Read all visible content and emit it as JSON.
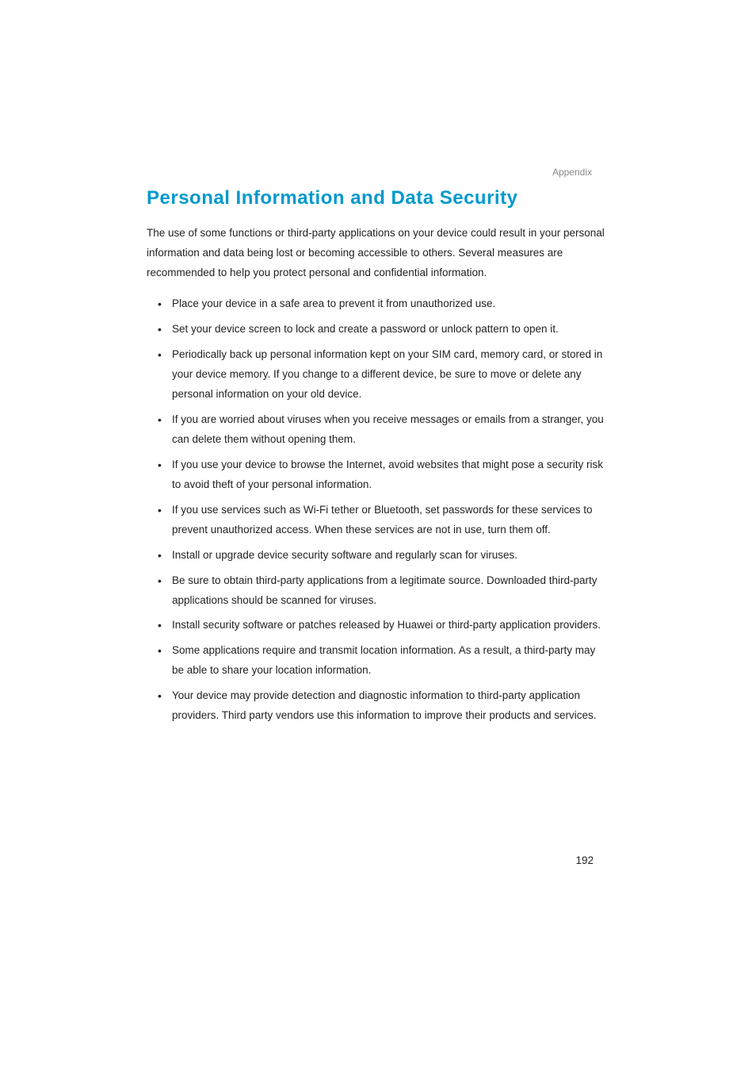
{
  "header": {
    "section_label": "Appendix"
  },
  "title": "Personal Information and Data Security",
  "intro": "The use of some functions or third-party applications on your device could result in your personal information and data being lost or becoming accessible to others. Several measures are recommended to help you protect personal and confidential information.",
  "bullets": [
    "Place your device in a safe area to prevent it from unauthorized use.",
    "Set your device screen to lock and create a password or unlock pattern to open it.",
    "Periodically back up personal information kept on your SIM card, memory card, or stored in your device memory. If you change to a different device, be sure to move or delete any personal information on your old device.",
    "If you are worried about viruses when you receive messages or emails from a stranger, you can delete them without opening them.",
    "If you use your device to browse the Internet, avoid websites that might pose a security risk to avoid theft of your personal information.",
    "If you use services such as Wi-Fi tether or Bluetooth, set passwords for these services to prevent unauthorized access. When these services are not in use, turn them off.",
    "Install or upgrade device security software and regularly scan for viruses.",
    "Be sure to obtain third-party applications from a legitimate source. Downloaded third-party applications should be scanned for viruses.",
    "Install security software or patches released by Huawei or third-party application providers.",
    "Some applications require and transmit location information. As a result, a third-party may be able to share your location information.",
    "Your device may provide detection and diagnostic information to third-party application providers. Third party vendors use this information to improve their products and services."
  ],
  "page_number": "192"
}
